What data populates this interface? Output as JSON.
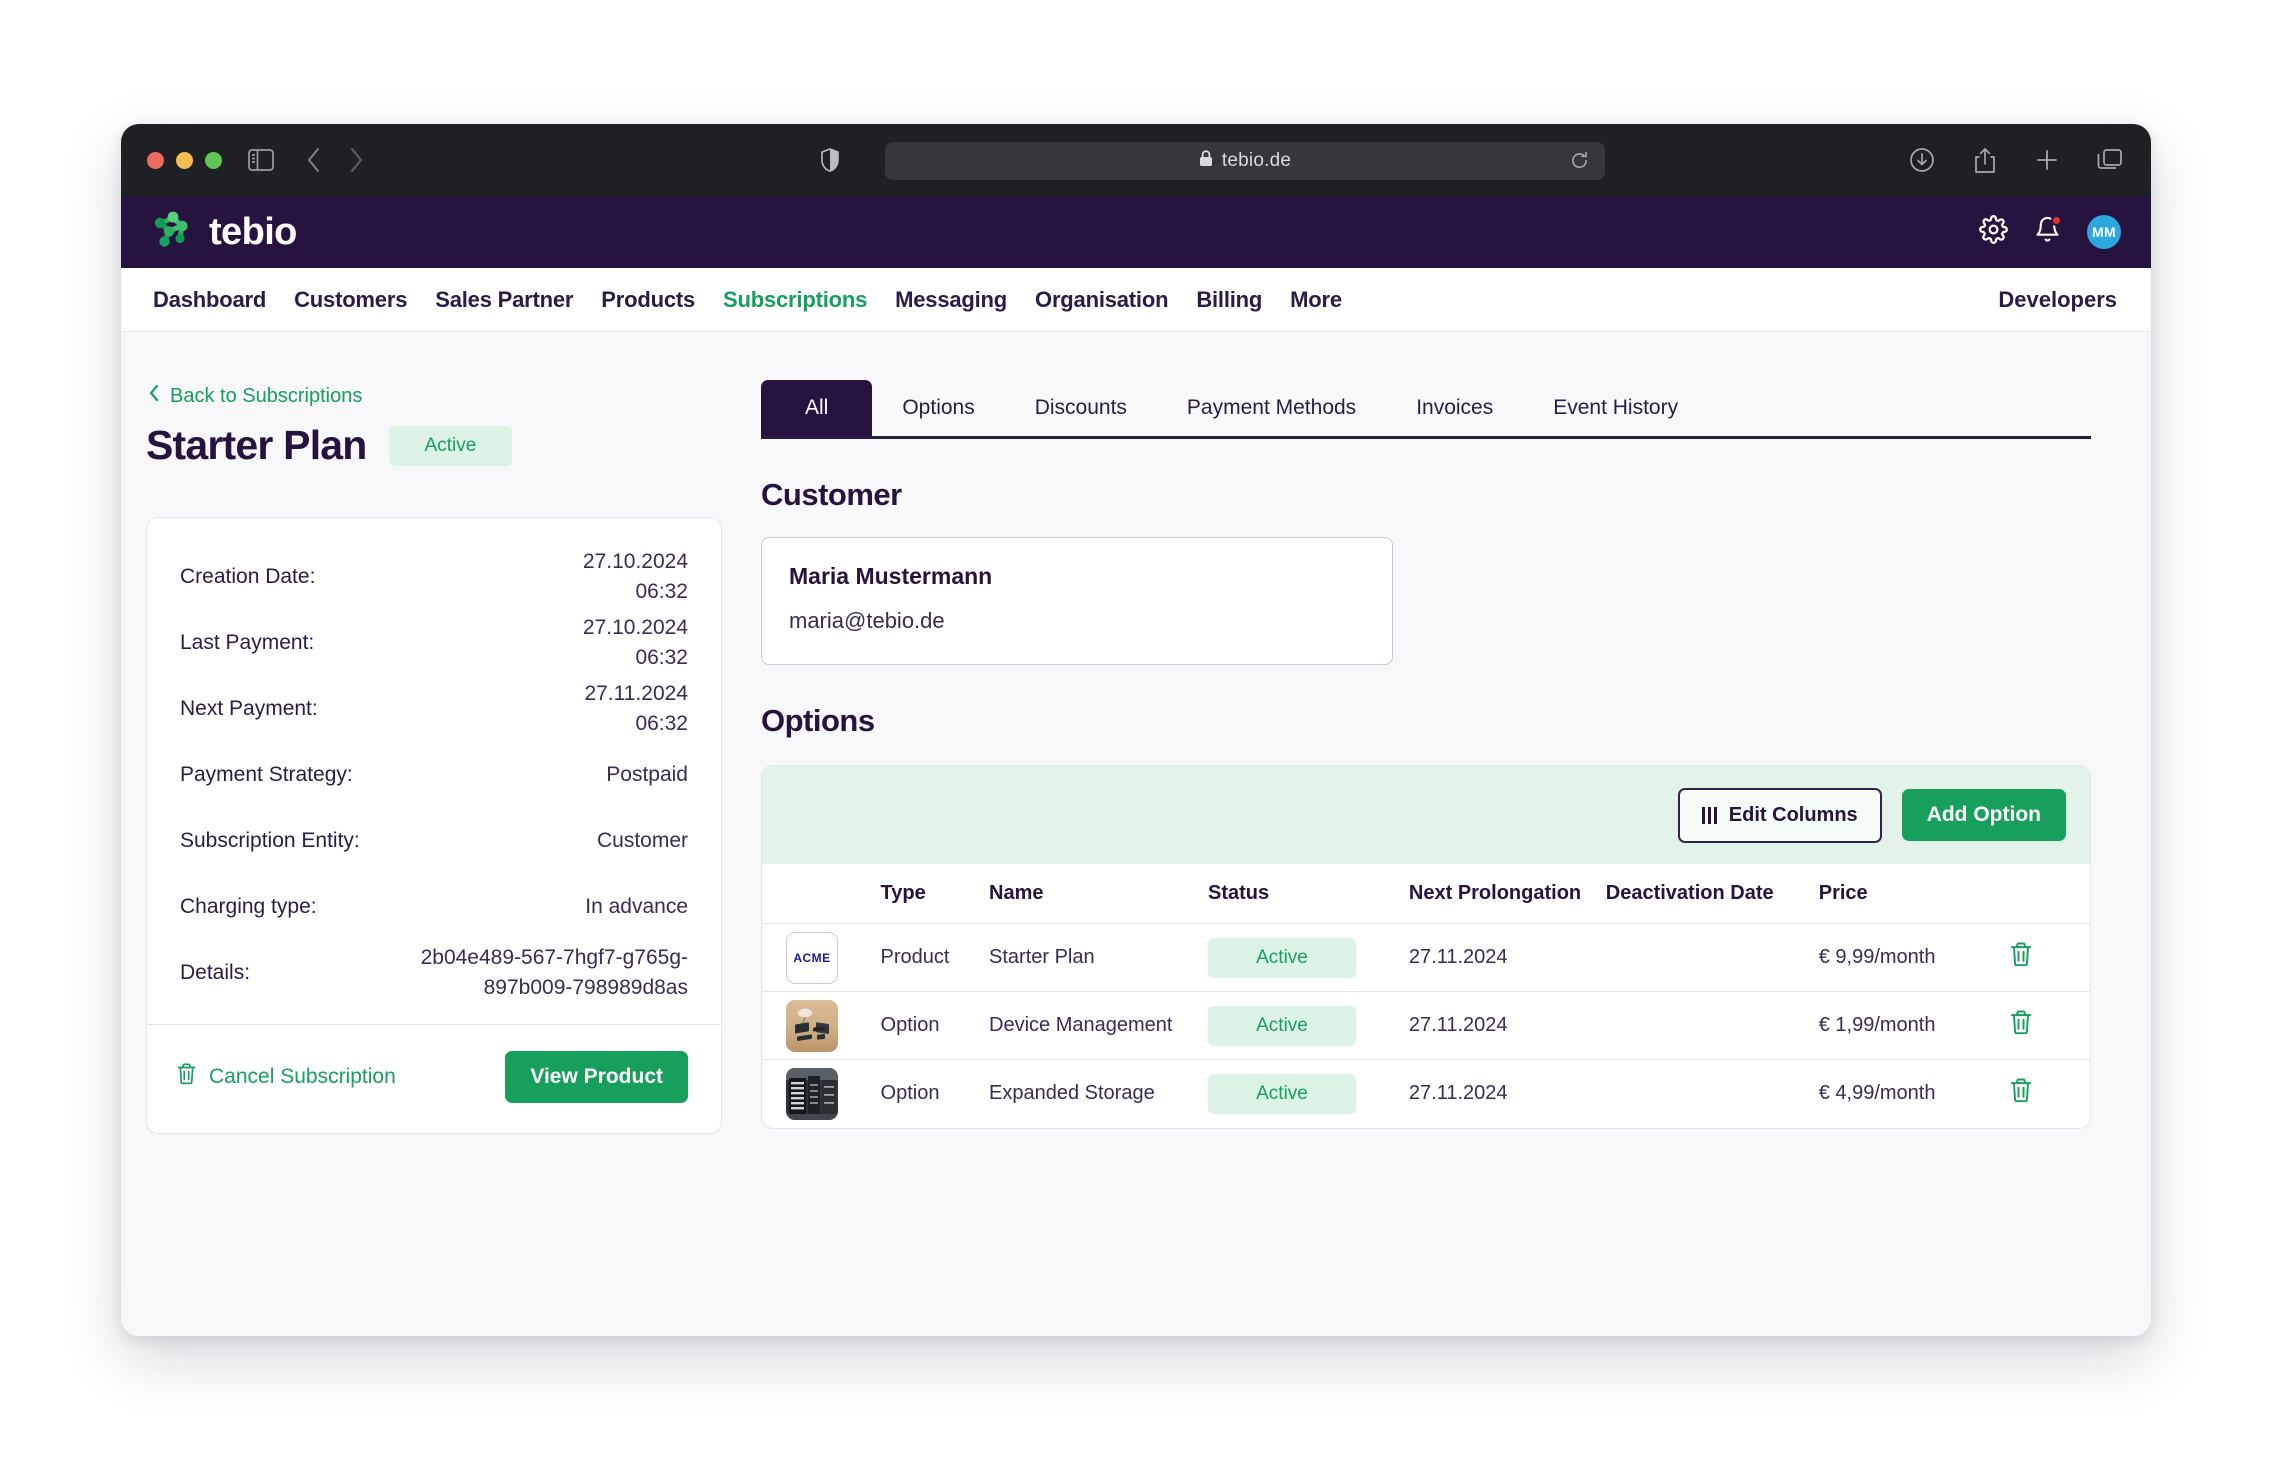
{
  "browser": {
    "url": "tebio.de",
    "lock_icon": "lock-icon",
    "icons": [
      "shield-icon",
      "reload-icon",
      "download-icon",
      "share-icon",
      "new-tab-icon",
      "tab-overview-icon"
    ]
  },
  "header": {
    "logo_text": "tebio",
    "avatar_initials": "MM",
    "icons": [
      "gear-icon",
      "bell-icon"
    ]
  },
  "nav": {
    "items": [
      {
        "label": "Dashboard",
        "active": false
      },
      {
        "label": "Customers",
        "active": false
      },
      {
        "label": "Sales Partner",
        "active": false
      },
      {
        "label": "Products",
        "active": false
      },
      {
        "label": "Subscriptions",
        "active": true
      },
      {
        "label": "Messaging",
        "active": false
      },
      {
        "label": "Organisation",
        "active": false
      },
      {
        "label": "Billing",
        "active": false
      },
      {
        "label": "More",
        "active": false
      }
    ],
    "developers_label": "Developers"
  },
  "page": {
    "back_link": "Back to Subscriptions",
    "title": "Starter Plan",
    "status_badge": "Active"
  },
  "details": {
    "rows": [
      {
        "label": "Creation Date:",
        "value": "27.10.2024\n06:32"
      },
      {
        "label": "Last Payment:",
        "value": "27.10.2024\n06:32"
      },
      {
        "label": "Next Payment:",
        "value": "27.11.2024\n06:32"
      },
      {
        "label": "Payment Strategy:",
        "value": "Postpaid"
      },
      {
        "label": "Subscription Entity:",
        "value": "Customer"
      },
      {
        "label": "Charging type:",
        "value": "In advance"
      },
      {
        "label": "Details:",
        "value": "2b04e489-567-7hgf7-g765g-\n897b009-798989d8as"
      }
    ],
    "cancel_label": "Cancel Subscription",
    "view_product_label": "View Product"
  },
  "tabs": [
    {
      "label": "All",
      "active": true
    },
    {
      "label": "Options",
      "active": false
    },
    {
      "label": "Discounts",
      "active": false
    },
    {
      "label": "Payment Methods",
      "active": false
    },
    {
      "label": "Invoices",
      "active": false
    },
    {
      "label": "Event History",
      "active": false
    }
  ],
  "customer": {
    "section_title": "Customer",
    "name": "Maria Mustermann",
    "email": "maria@tebio.de"
  },
  "options": {
    "section_title": "Options",
    "edit_columns_label": "Edit Columns",
    "add_option_label": "Add Option",
    "columns": [
      "",
      "Type",
      "Name",
      "Status",
      "Next Prolongation",
      "Deactivation Date",
      "Price",
      ""
    ],
    "rows": [
      {
        "thumb": "acme-logo-thumbnail",
        "thumb_text": "ACME",
        "type": "Product",
        "name": "Starter Plan",
        "status": "Active",
        "next_prolongation": "27.11.2024",
        "deactivation_date": "",
        "price": "€ 9,99/month"
      },
      {
        "thumb": "devices-photo-thumbnail",
        "thumb_text": "",
        "type": "Option",
        "name": "Device Management",
        "status": "Active",
        "next_prolongation": "27.11.2024",
        "deactivation_date": "",
        "price": "€ 1,99/month"
      },
      {
        "thumb": "server-rack-photo-thumbnail",
        "thumb_text": "",
        "type": "Option",
        "name": "Expanded Storage",
        "status": "Active",
        "next_prolongation": "27.11.2024",
        "deactivation_date": "",
        "price": "€ 4,99/month"
      }
    ]
  },
  "colors": {
    "brand_purple": "#271340",
    "brand_green": "#16a05c",
    "accent_blue": "#2aa7df",
    "badge_bg": "#ddf3e6",
    "toolbar_bg": "#e4f3ea",
    "notification_red": "#e2342a"
  }
}
